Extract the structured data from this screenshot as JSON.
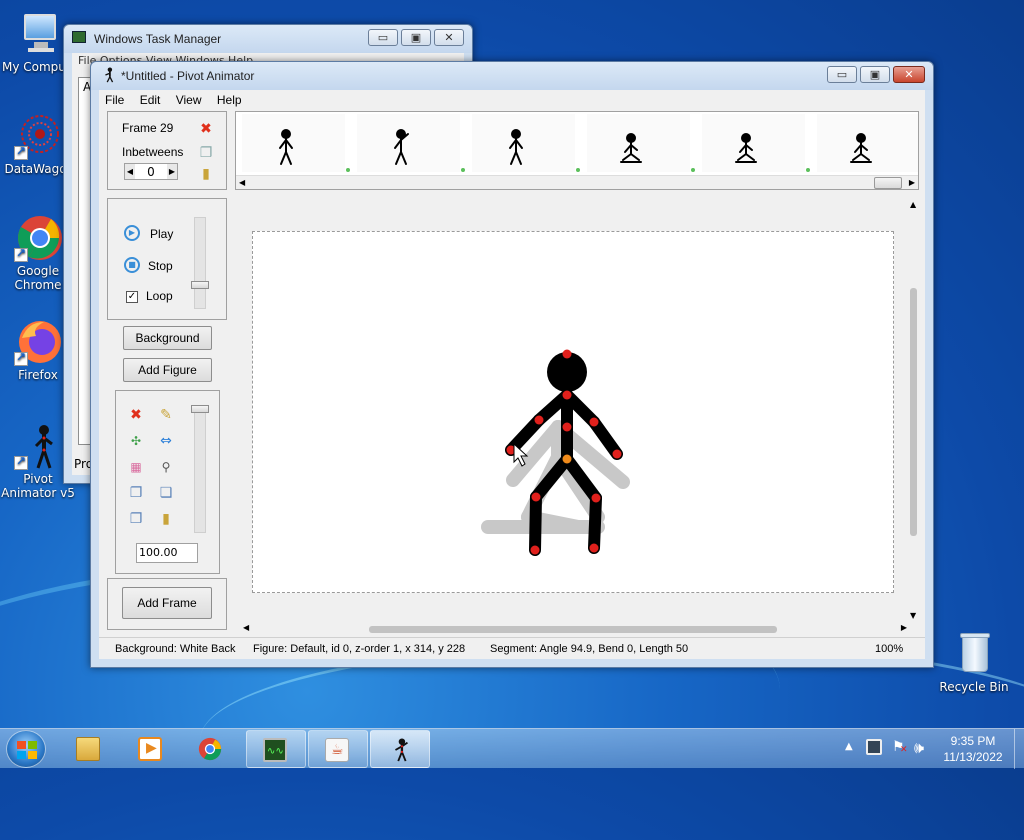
{
  "desktop": {
    "icons": [
      {
        "label": "My Compu"
      },
      {
        "label": "DataWagor"
      },
      {
        "label": "Google\nChrome"
      },
      {
        "label": "Firefox"
      },
      {
        "label": "Pivot\nAnimator v5"
      },
      {
        "label": "Recycle Bin"
      }
    ]
  },
  "task_manager": {
    "title": "Windows Task Manager",
    "menu_partial": "File  Options  View  Windows  Help",
    "list_first": "A",
    "bottom_partial": "Pro"
  },
  "pivot": {
    "title": "*Untitled - Pivot Animator",
    "menu": [
      "File",
      "Edit",
      "View",
      "Help"
    ],
    "frame_label": "Frame 29",
    "inbetweens_label": "Inbetweens",
    "inbetweens_value": "0",
    "play_label": "Play",
    "stop_label": "Stop",
    "loop_label": "Loop",
    "loop_checked": true,
    "background_button": "Background",
    "add_figure_button": "Add Figure",
    "scale_value": "100.00",
    "add_frame_button": "Add Frame",
    "status": {
      "background": "Background: White Back",
      "figure": "Figure: Default,  id 0,  z-order 1,  x 314, y 228",
      "segment": "Segment: Angle 94.9,  Bend 0,  Length 50",
      "zoom": "100%"
    }
  },
  "taskbar": {
    "time": "9:35 PM",
    "date": "11/13/2022"
  },
  "colors": {
    "joint_red": "#e0201c",
    "joint_orange": "#f08a1a",
    "shadow_figure": "#c8c8c8"
  }
}
